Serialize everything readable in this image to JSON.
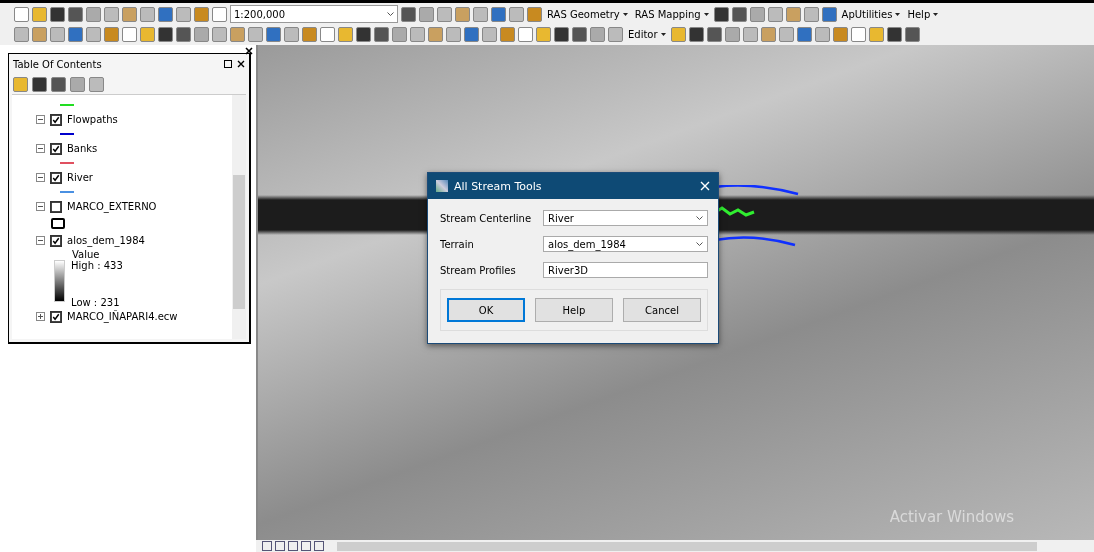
{
  "toolbar": {
    "scale": "1:200,000",
    "menus": [
      {
        "label": "RAS Geometry"
      },
      {
        "label": "RAS Mapping"
      },
      {
        "label": "ApUtilities"
      },
      {
        "label": "Help"
      }
    ],
    "editor": "Editor"
  },
  "toc": {
    "title": "Table Of Contents",
    "top_symbol": {
      "color": "#22dd22"
    },
    "layers": [
      {
        "name": "Flowpaths",
        "expanded": true,
        "checked": true,
        "legend": {
          "kind": "line",
          "color": "#0000cc"
        }
      },
      {
        "name": "Banks",
        "expanded": true,
        "checked": true,
        "legend": {
          "kind": "line",
          "color": "#e05060"
        }
      },
      {
        "name": "River",
        "expanded": true,
        "checked": true,
        "legend": {
          "kind": "line",
          "color": "#4a90e2"
        }
      },
      {
        "name": "MARCO_EXTERNO",
        "expanded": true,
        "checked": false,
        "legend": {
          "kind": "box"
        }
      },
      {
        "name": "alos_dem_1984",
        "expanded": true,
        "checked": true,
        "legend": {
          "kind": "ramp",
          "title": "Value",
          "high": "High : 433",
          "low": "Low : 231"
        }
      },
      {
        "name": "MARCO_IÑAPARI4.ecw",
        "expanded": false,
        "checked": true
      }
    ]
  },
  "dialog": {
    "title": "All Stream Tools",
    "fields": [
      {
        "label": "Stream Centerline",
        "kind": "combo",
        "value": "River"
      },
      {
        "label": "Terrain",
        "kind": "combo",
        "value": "alos_dem_1984"
      },
      {
        "label": "Stream Profiles",
        "kind": "text",
        "value": "River3D"
      }
    ],
    "buttons": [
      {
        "label": "OK",
        "selected": true
      },
      {
        "label": "Help",
        "selected": false
      },
      {
        "label": "Cancel",
        "selected": false
      }
    ]
  },
  "watermark_os": "Activar Windows"
}
